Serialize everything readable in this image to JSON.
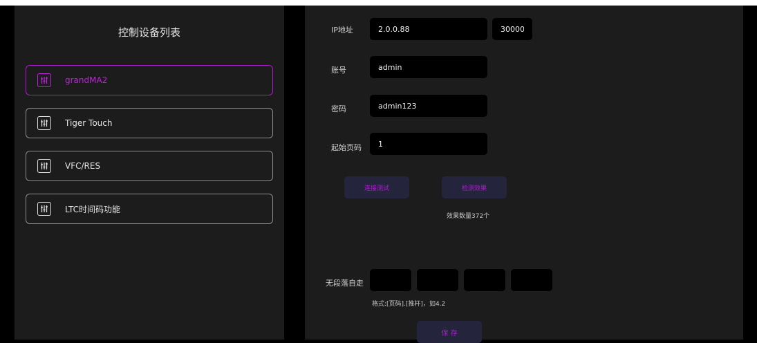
{
  "left_panel": {
    "title": "控制设备列表",
    "devices": [
      {
        "label": "grandMA2",
        "active": true
      },
      {
        "label": "Tiger Touch",
        "active": false
      },
      {
        "label": "VFC/RES",
        "active": false
      },
      {
        "label": "LTC时间码功能",
        "active": false
      }
    ]
  },
  "form": {
    "ip_label": "IP地址",
    "ip_value": "2.0.0.88",
    "port_value": "30000",
    "account_label": "账号",
    "account_value": "admin",
    "password_label": "密码",
    "password_value": "admin123",
    "start_page_label": "起始页码",
    "start_page_value": "1",
    "connect_test_label": "连接测试",
    "detect_effect_label": "检测效果",
    "effect_count_text": "效果数量372个",
    "no_segment_label": "无段落自走",
    "no_segment_values": [
      "",
      "",
      "",
      ""
    ],
    "format_hint": "格式:[页码].[推杆]，如4.2",
    "save_label": "保 存"
  },
  "colors": {
    "accent": "#b01ad1",
    "panel_bg": "#1c1c1c",
    "button_bg": "#24243c"
  }
}
